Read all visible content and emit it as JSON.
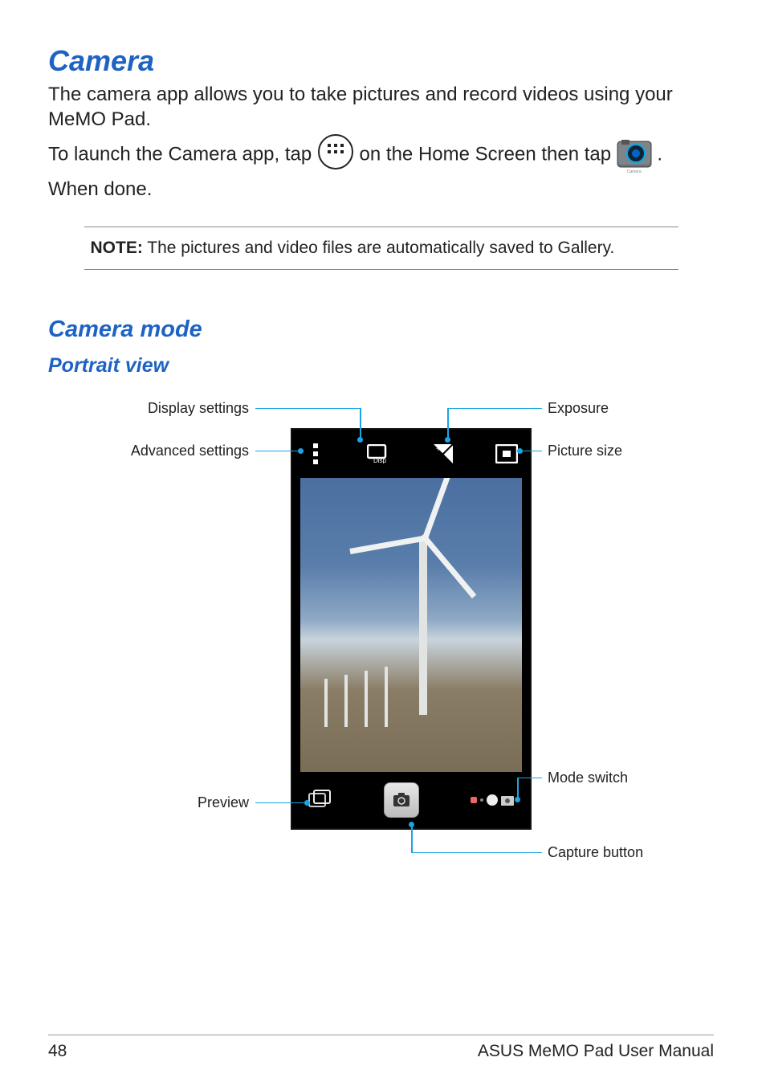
{
  "title": "Camera",
  "intro": "The camera app allows you to take pictures and record videos using your MeMO Pad.",
  "launch_pre": "To launch the Camera app, tap ",
  "launch_mid": " on the Home Screen then tap ",
  "launch_post": ". When done.",
  "camera_icon_label": "Camera",
  "note_label": "NOTE:",
  "note_text": " The pictures and video files are automatically saved to Gallery.",
  "h2": "Camera mode",
  "h3": "Portrait view",
  "callouts": {
    "display_settings": "Display settings",
    "advanced_settings": "Advanced settings",
    "exposure": "Exposure",
    "picture_size": "Picture size",
    "mode_switch": "Mode switch",
    "preview": "Preview",
    "capture_button": "Capture button"
  },
  "footer": {
    "page": "48",
    "manual": "ASUS MeMO Pad User Manual"
  }
}
